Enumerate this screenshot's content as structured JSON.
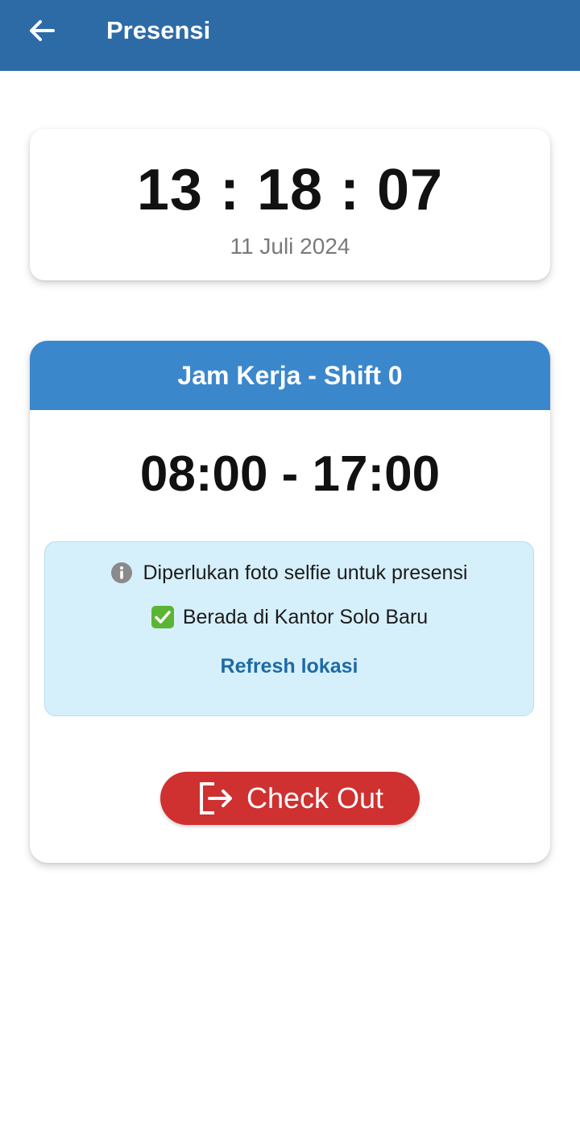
{
  "appbar": {
    "title": "Presensi",
    "back_icon": "arrow-left-icon",
    "background": "#2d6ba6"
  },
  "clock": {
    "time": "13 : 18 : 07",
    "date": "11 Juli 2024"
  },
  "shift": {
    "header": "Jam Kerja - Shift 0",
    "header_color": "#3b87cc",
    "hours": "08:00 - 17:00",
    "info": {
      "selfie_note": "Diperlukan foto selfie untuk presensi",
      "selfie_icon": "info-icon",
      "location_status": "Berada di Kantor Solo Baru",
      "location_icon": "check-mark-icon",
      "refresh_label": "Refresh lokasi"
    },
    "action": {
      "label": "Check Out",
      "icon": "logout-icon",
      "color": "#cf3030"
    }
  }
}
